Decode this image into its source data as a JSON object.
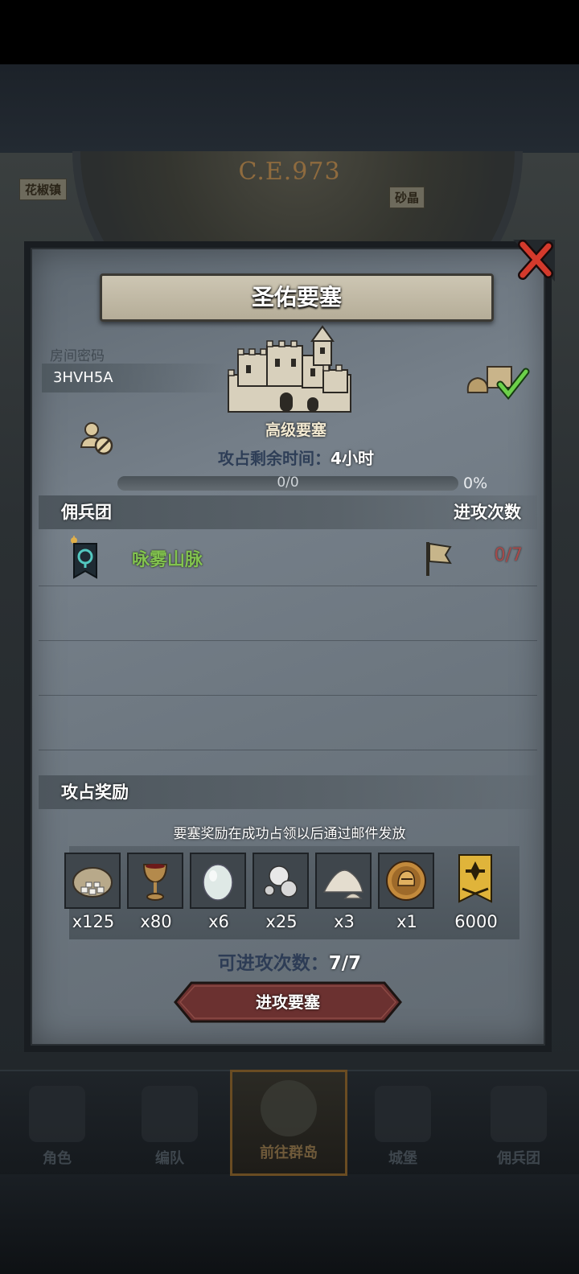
{
  "background": {
    "era": "C.E.973",
    "map_labels": [
      "花椒镇",
      "砂晶"
    ]
  },
  "modal": {
    "title": "圣佑要塞",
    "room_label": "房间密码",
    "room_code": "3HVH5A",
    "fort_grade": "高级要塞",
    "time_label": "攻占剩余时间：",
    "time_value": "4小时",
    "progress_text": "0/0",
    "progress_percent": "0%",
    "progress_fraction": 0,
    "mercenary_header": "佣兵团",
    "attack_count_header": "进攻次数",
    "guilds": [
      {
        "name": "咏雾山脉",
        "attacks": "0/7"
      }
    ],
    "rewards_header": "攻占奖励",
    "rewards_note": "要塞奖励在成功占领以后通过邮件发放",
    "rewards": [
      {
        "icon": "ore-sack-icon",
        "qty": "x125"
      },
      {
        "icon": "goblet-icon",
        "qty": "x80"
      },
      {
        "icon": "gem-stone-icon",
        "qty": "x6"
      },
      {
        "icon": "pearls-icon",
        "qty": "x25"
      },
      {
        "icon": "powder-pile-icon",
        "qty": "x3"
      },
      {
        "icon": "knight-helmet-coin-icon",
        "qty": "x1"
      },
      {
        "icon": "honor-banner-icon",
        "qty": "6000"
      }
    ],
    "available_label": "可进攻次数：",
    "available_value": "7/7",
    "attack_button": "进攻要塞"
  },
  "nav": [
    {
      "label": "角色",
      "icon": "knight-icon"
    },
    {
      "label": "编队",
      "icon": "formation-icon"
    },
    {
      "label": "前往群岛",
      "icon": "island-compass-icon"
    },
    {
      "label": "城堡",
      "icon": "castle-icon"
    },
    {
      "label": "佣兵团",
      "icon": "mercenary-ship-icon"
    }
  ],
  "colors": {
    "guild_name": "#82c24f",
    "attack_count": "#a64a4a",
    "attack_button": "#6b3130",
    "panel": "#6c767f"
  }
}
